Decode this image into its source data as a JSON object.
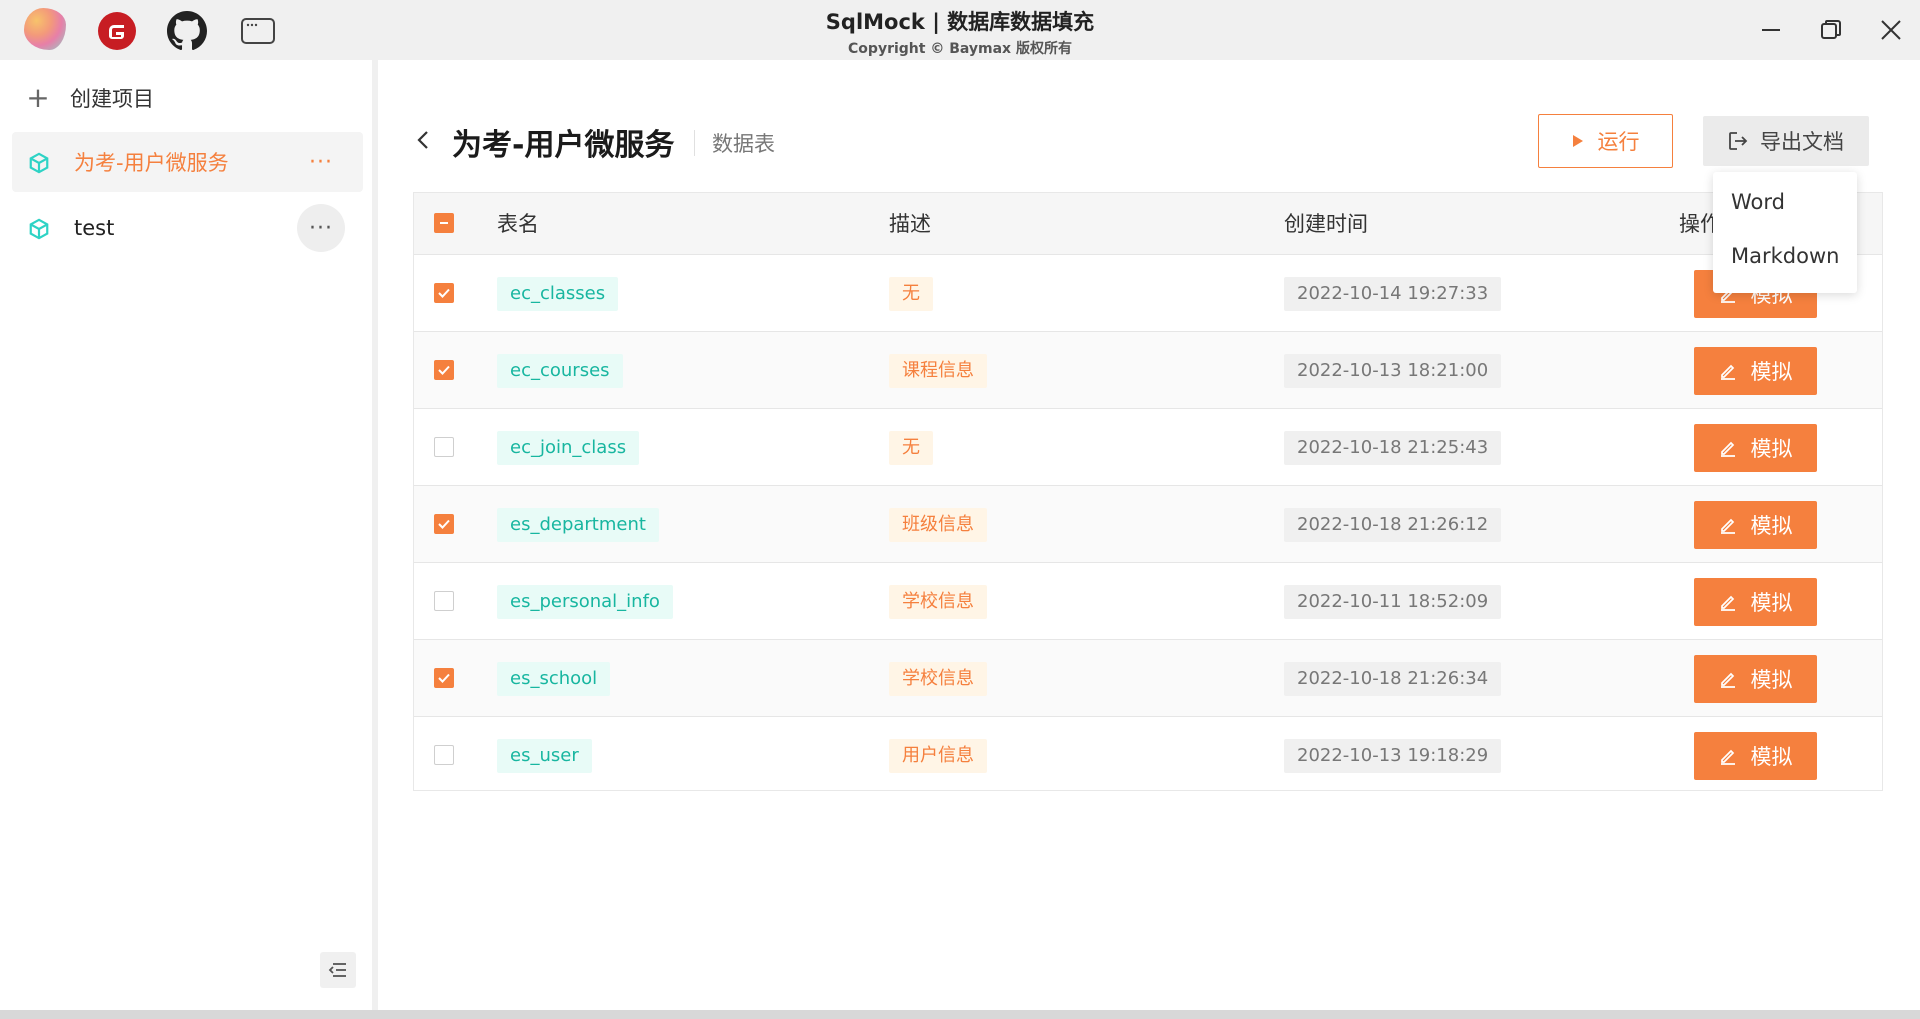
{
  "titlebar": {
    "title": "SqlMock | 数据库数据填充",
    "copyright": "Copyright © Baymax 版权所有",
    "icons": [
      "app-logo",
      "gitee-icon",
      "github-icon",
      "window-icon"
    ],
    "controls": [
      "minimize-icon",
      "maximize-icon",
      "close-icon"
    ]
  },
  "sidebar": {
    "create_label": "创建项目",
    "projects": [
      {
        "label": "为考-用户微服务",
        "active": true
      },
      {
        "label": "test",
        "active": false
      }
    ],
    "more_glyph": "···"
  },
  "header": {
    "title": "为考-用户微服务",
    "subtitle": "数据表",
    "run_label": "运行",
    "export_label": "导出文档"
  },
  "export_menu": {
    "items": [
      "Word",
      "Markdown"
    ]
  },
  "table": {
    "columns": [
      "表名",
      "描述",
      "创建时间",
      "操作"
    ],
    "mock_label": "模拟",
    "rows": [
      {
        "checked": true,
        "name": "ec_classes",
        "desc": "无",
        "time": "2022-10-14 19:27:33"
      },
      {
        "checked": true,
        "name": "ec_courses",
        "desc": "课程信息",
        "time": "2022-10-13 18:21:00"
      },
      {
        "checked": false,
        "name": "ec_join_class",
        "desc": "无",
        "time": "2022-10-18 21:25:43"
      },
      {
        "checked": true,
        "name": "es_department",
        "desc": "班级信息",
        "time": "2022-10-18 21:26:12"
      },
      {
        "checked": false,
        "name": "es_personal_info",
        "desc": "学校信息",
        "time": "2022-10-11 18:52:09"
      },
      {
        "checked": true,
        "name": "es_school",
        "desc": "学校信息",
        "time": "2022-10-18 21:26:34"
      },
      {
        "checked": false,
        "name": "es_user",
        "desc": "用户信息",
        "time": "2022-10-13 19:18:29"
      }
    ]
  },
  "colors": {
    "accent": "#f5803e",
    "name_tag_bg": "#e8fbf7",
    "name_tag_fg": "#18b6a0",
    "desc_tag_bg": "#fff5e6",
    "cube_icon": "#2ed3c5"
  }
}
